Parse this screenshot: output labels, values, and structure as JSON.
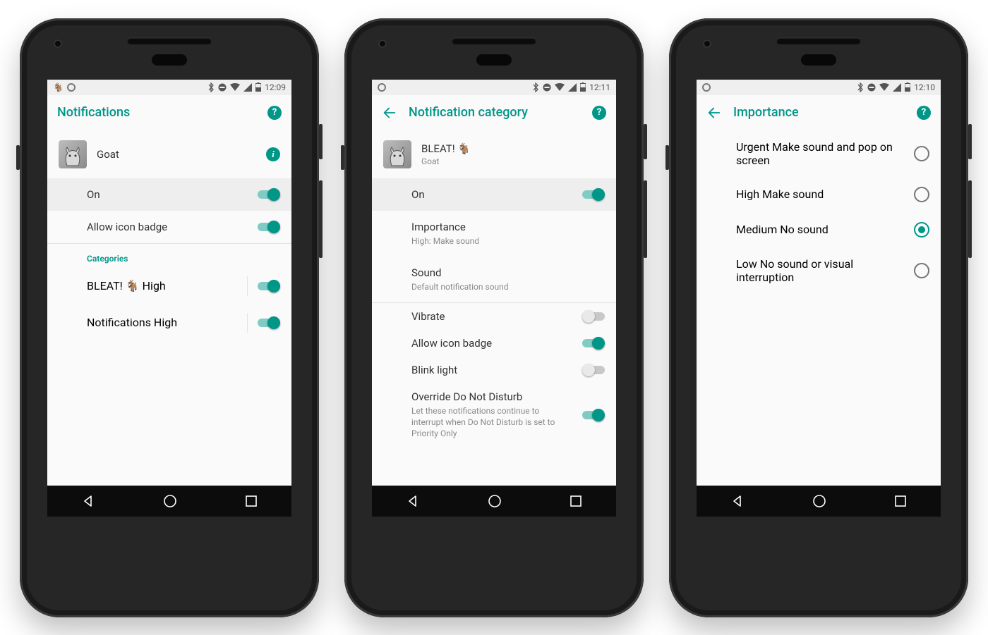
{
  "phone1": {
    "status_time": "12:09",
    "title": "Notifications",
    "app_name": "Goat",
    "on_label": "On",
    "on_state": true,
    "badge_label": "Allow icon badge",
    "badge_state": true,
    "categories_section": "Categories",
    "categories": [
      {
        "name": "BLEAT! 🐐",
        "sub": "High",
        "state": true
      },
      {
        "name": "Notifications",
        "sub": "High",
        "state": true
      }
    ]
  },
  "phone2": {
    "status_time": "12:11",
    "title": "Notification category",
    "channel_name": "BLEAT! 🐐",
    "channel_sub": "Goat",
    "on_label": "On",
    "on_state": true,
    "importance_label": "Importance",
    "importance_sub": "High: Make sound",
    "sound_label": "Sound",
    "sound_sub": "Default notification sound",
    "vibrate_label": "Vibrate",
    "vibrate_state": false,
    "badge_label": "Allow icon badge",
    "badge_state": true,
    "blink_label": "Blink light",
    "blink_state": false,
    "dnd_label": "Override Do Not Disturb",
    "dnd_sub": "Let these notifications continue to interrupt when Do Not Disturb is set to Priority Only",
    "dnd_state": true
  },
  "phone3": {
    "status_time": "12:10",
    "title": "Importance",
    "options": [
      {
        "name": "Urgent",
        "sub": "Make sound and pop on screen",
        "selected": false
      },
      {
        "name": "High",
        "sub": "Make sound",
        "selected": false
      },
      {
        "name": "Medium",
        "sub": "No sound",
        "selected": true
      },
      {
        "name": "Low",
        "sub": "No sound or visual interruption",
        "selected": false
      }
    ]
  }
}
